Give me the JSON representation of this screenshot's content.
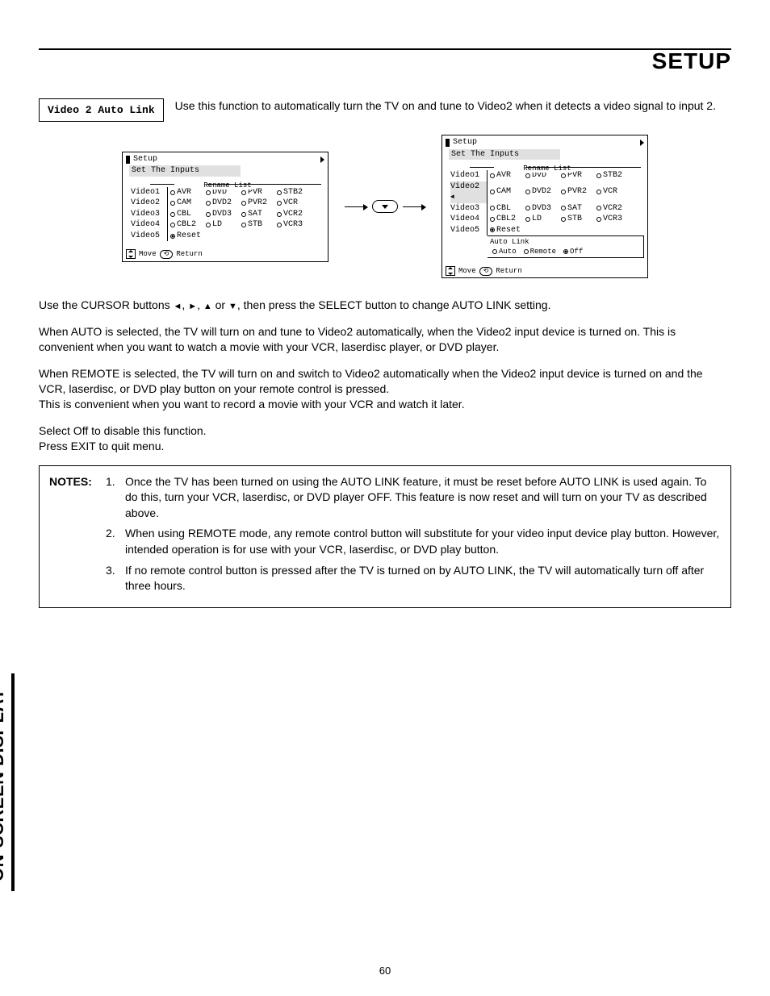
{
  "title": "SETUP",
  "side_tab": "ON-SCREEN DISPLAY",
  "page_number": "60",
  "feature": {
    "name": "Video 2 Auto Link",
    "description": "Use this function to automatically turn the TV on and tune to Video2 when it detects a video signal to input 2."
  },
  "screens": {
    "header": "Setup",
    "subheader": "Set The Inputs",
    "rename_title": "Rename List",
    "rows": [
      {
        "label": "Video1",
        "opts": [
          "AVR",
          "DVD",
          "PVR",
          "STB2"
        ]
      },
      {
        "label": "Video2",
        "opts": [
          "CAM",
          "DVD2",
          "PVR2",
          "VCR"
        ]
      },
      {
        "label": "Video3",
        "opts": [
          "CBL",
          "DVD3",
          "SAT",
          "VCR2"
        ]
      },
      {
        "label": "Video4",
        "opts": [
          "CBL2",
          "LD",
          "STB",
          "VCR3"
        ]
      },
      {
        "label": "Video5",
        "reset": "Reset"
      }
    ],
    "auto_link": {
      "title": "Auto Link",
      "opts": [
        "Auto",
        "Remote",
        "Off"
      ]
    },
    "footer": {
      "move": "Move",
      "return": "Return"
    }
  },
  "paragraphs": {
    "p1a": "Use the CURSOR buttons ",
    "p1b": ", then press the SELECT button to change AUTO LINK setting.",
    "p2": "When AUTO is selected, the TV will turn on and tune to Video2 automatically, when the Video2 input device is turned on. This is convenient when you want to watch a movie with your VCR, laserdisc player, or DVD player.",
    "p3": "When REMOTE is selected, the TV will turn on and switch to Video2 automatically when the Video2 input device is turned on and the VCR, laserdisc, or DVD play button on your remote control is pressed.",
    "p4": "This is convenient when you want to record a movie with your VCR and watch it later.",
    "p5": "Select Off to disable this function.",
    "p6": "Press EXIT to quit menu."
  },
  "notes": {
    "label": "NOTES:",
    "items": [
      "Once the TV has been turned on using the AUTO LINK feature, it must be reset before AUTO LINK is used again. To do this, turn your VCR, laserdisc, or DVD player OFF. This feature is now reset and will turn on your TV as described above.",
      "When using REMOTE mode, any remote control button will substitute for your video input device play button. However, intended operation is for use with your VCR, laserdisc, or DVD play button.",
      "If no remote control button is pressed after the TV is turned on by AUTO LINK, the TV will automatically turn off after three hours."
    ]
  }
}
